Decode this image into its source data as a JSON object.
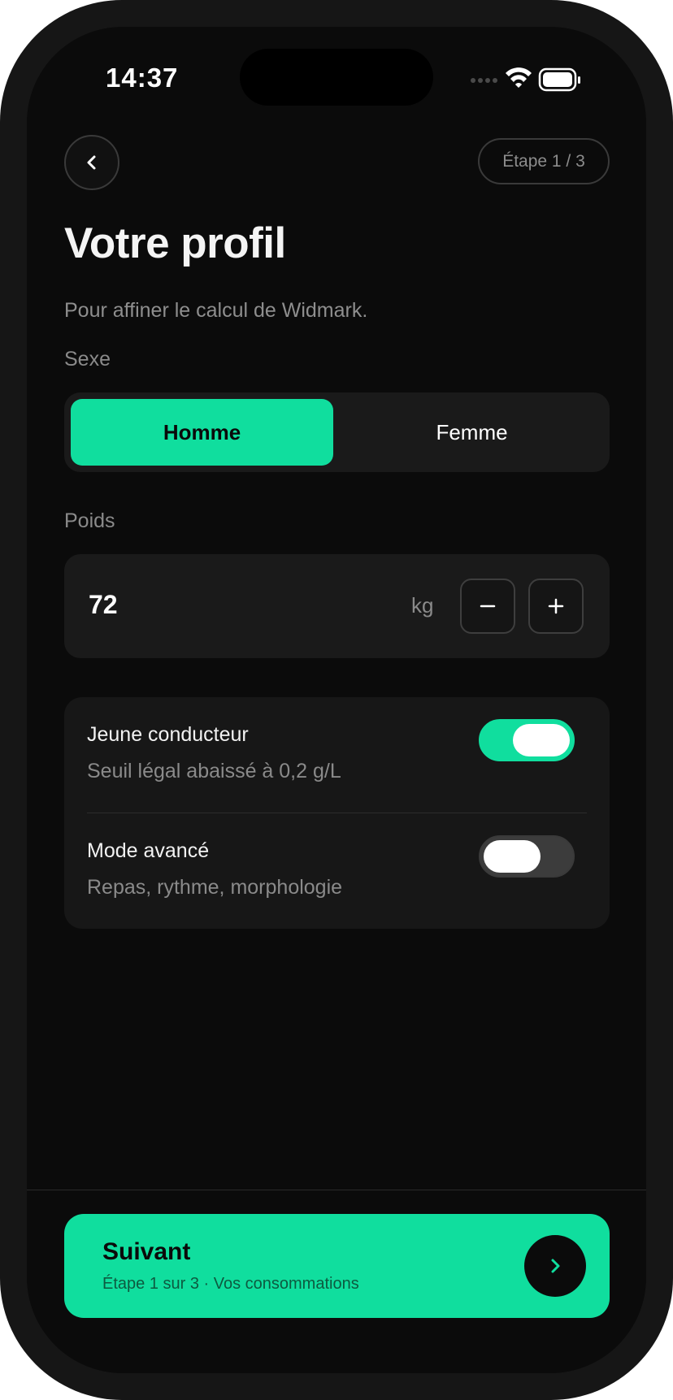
{
  "status_bar": {
    "time": "14:37"
  },
  "header": {
    "step": "Étape 1 / 3"
  },
  "page": {
    "title": "Votre profil",
    "subtitle": "Pour affiner le calcul de Widmark."
  },
  "sex": {
    "label": "Sexe",
    "options": [
      "Homme",
      "Femme"
    ],
    "selected": "Homme"
  },
  "weight": {
    "label": "Poids",
    "value": "72",
    "unit": "kg"
  },
  "options": [
    {
      "title": "Jeune conducteur",
      "subtitle": "Seuil légal abaissé à 0,2 g/L",
      "enabled": true
    },
    {
      "title": "Mode avancé",
      "subtitle": "Repas, rythme, morphologie",
      "enabled": false
    }
  ],
  "next": {
    "label": "Suivant",
    "sublabel": "Étape 1 sur 3 · Vos consommations"
  },
  "colors": {
    "accent": "#10de9e",
    "background": "#0b0b0b",
    "card": "#1a1a1a"
  },
  "icons": {
    "back": "chevron-left-icon",
    "minus": "minus-icon",
    "plus": "plus-icon",
    "next": "chevron-right-icon",
    "wifi": "wifi-icon",
    "battery": "battery-icon",
    "signal": "cellular-signal-icon"
  }
}
